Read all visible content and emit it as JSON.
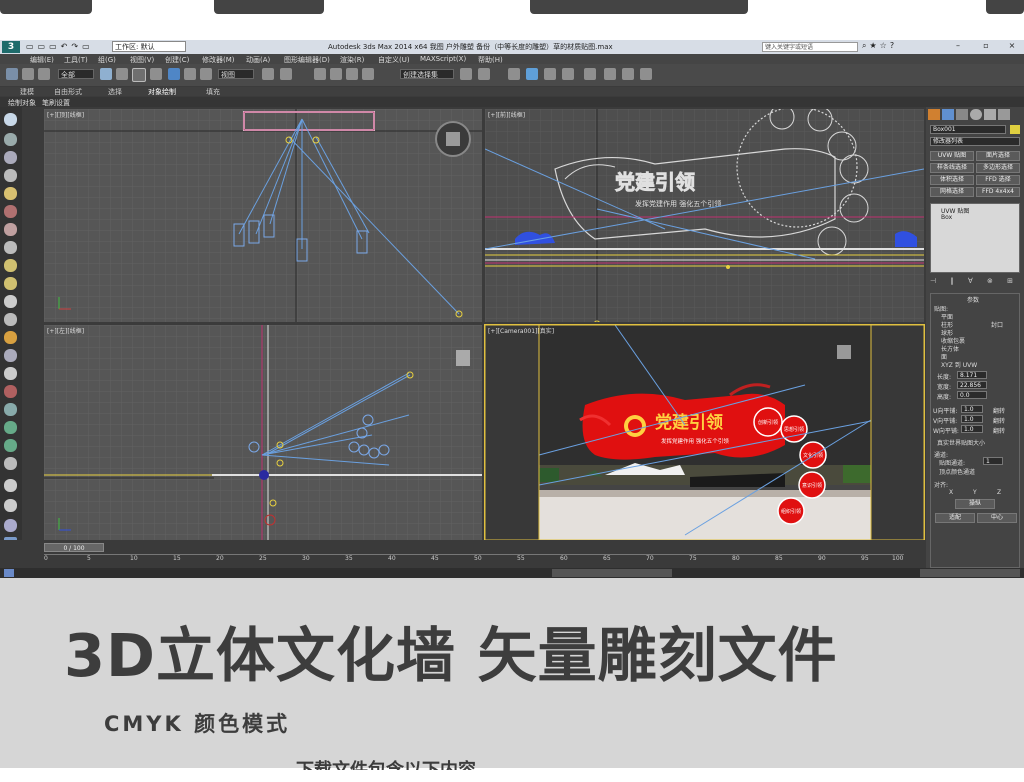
{
  "app": {
    "title": "Autodesk 3ds Max  2014 x64      我图  户外雕塑  备份（中等长度的雕塑）草的材质贴图.max",
    "workspace": "工作区: 默认",
    "search_placeholder": "键入关键字或短语",
    "window_controls": [
      "–",
      "▫",
      "×"
    ]
  },
  "menu": [
    "编辑(E)",
    "工具(T)",
    "组(G)",
    "视图(V)",
    "创建(C)",
    "修改器(M)",
    "动画(A)",
    "图形编辑器(D)",
    "渲染(R)",
    "自定义(U)",
    "MAXScript(X)",
    "帮助(H)"
  ],
  "toolbar": {
    "filter": "全部",
    "ref_coord": "视图",
    "named_sel": "创建选择集"
  },
  "ribbon_tabs": [
    "建模",
    "自由形式",
    "选择",
    "对象绘制",
    "填充"
  ],
  "sub_tabs": [
    "绘制对象",
    "笔刷设置"
  ],
  "viewports": {
    "top": "[+][顶][线框]",
    "front": "[+][前][线框]",
    "left": "[+][左][线框]",
    "camera": "[+][Camera001][真实]"
  },
  "scene": {
    "sign_title": "党建引领",
    "sign_sub": "发挥党建作用  强化五个引领",
    "bubbles": [
      "创新引领",
      "思想引领",
      "文化引领",
      "意识引领",
      "组织引领"
    ]
  },
  "command_panel": {
    "object_name": "Box001",
    "modifier_list": "修改器列表",
    "buttons": [
      "UVW 贴图",
      "面片选择",
      "样条线选择",
      "多边形选择",
      "体积选择",
      "FFD 选择",
      "网格选择",
      "FFD 4x4x4"
    ],
    "stack": [
      "UVW 贴图",
      "Box"
    ],
    "params_title": "参数",
    "mapping_label": "贴图:",
    "mapping_options": [
      "平面",
      "柱形",
      "封口",
      "球形",
      "收缩包裹",
      "长方体",
      "面",
      "XYZ 到 UVW"
    ],
    "length_label": "长度:",
    "length": "8.171",
    "width_label": "宽度:",
    "width": "22.856",
    "height_label": "高度:",
    "height": "0.0",
    "u_tile_label": "U向平铺:",
    "u_tile": "1.0",
    "v_tile_label": "V向平铺:",
    "v_tile": "1.0",
    "w_tile_label": "W向平铺:",
    "w_tile": "1.0",
    "flip": "翻转",
    "real_world": "真实世界贴图大小",
    "channel_title": "通道:",
    "map_channel_label": "贴图通道:",
    "map_channel": "1",
    "vertex_color": "顶点颜色通道",
    "align_title": "对齐:",
    "axes": [
      "X",
      "Y",
      "Z"
    ],
    "operate": "操纵",
    "fit": "适配",
    "center": "中心"
  },
  "timeline": {
    "slider": "0 / 100",
    "ticks": [
      "0",
      "5",
      "10",
      "15",
      "20",
      "25",
      "30",
      "35",
      "40",
      "45",
      "50",
      "55",
      "60",
      "65",
      "70",
      "75",
      "80",
      "85",
      "90",
      "95",
      "100"
    ]
  },
  "headline": "3D立体文化墙  矢量雕刻文件",
  "subtitle": "CMYK 颜色模式",
  "bottom_text": "下载文件包含以下内容"
}
